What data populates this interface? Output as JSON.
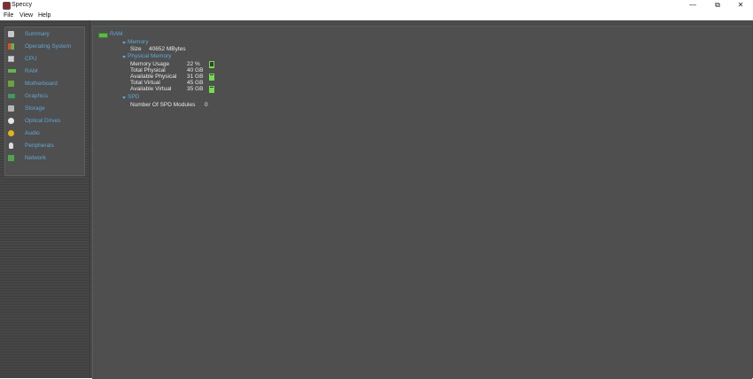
{
  "window": {
    "title": "Speccy",
    "minimize": "—",
    "restore": "⧉",
    "close": "✕"
  },
  "menu": [
    "File",
    "View",
    "Help"
  ],
  "sidebar": {
    "items": [
      {
        "label": "Summary",
        "icon": "summary-icon",
        "color": "#c8c8c8"
      },
      {
        "label": "Operating System",
        "icon": "windows-icon",
        "color": "#d97a2b"
      },
      {
        "label": "CPU",
        "icon": "cpu-icon",
        "color": "#cfcfcf"
      },
      {
        "label": "RAM",
        "icon": "ram-icon",
        "color": "#5fb84a"
      },
      {
        "label": "Motherboard",
        "icon": "motherboard-icon",
        "color": "#6aa43d"
      },
      {
        "label": "Graphics",
        "icon": "graphics-card-icon",
        "color": "#3f9a5a"
      },
      {
        "label": "Storage",
        "icon": "storage-icon",
        "color": "#b7b7b7"
      },
      {
        "label": "Optical Drives",
        "icon": "optical-drive-icon",
        "color": "#e5e5e5"
      },
      {
        "label": "Audio",
        "icon": "audio-icon",
        "color": "#e2b51c"
      },
      {
        "label": "Peripherals",
        "icon": "peripherals-icon",
        "color": "#dcdcdc"
      },
      {
        "label": "Network",
        "icon": "network-icon",
        "color": "#4fa54f"
      }
    ]
  },
  "content": {
    "heading": "RAM",
    "memory_section": "Memory",
    "size_label": "Size",
    "size_value": "40652 MBytes",
    "physical_section": "Physical Memory",
    "rows": [
      {
        "label": "Memory Usage",
        "value": "22 %",
        "level": 0.22
      },
      {
        "label": "Total Physical",
        "value": "40 GB"
      },
      {
        "label": "Available Physical",
        "value": "31 GB",
        "level": 0.78
      },
      {
        "label": "Total Virtual",
        "value": "45 GB"
      },
      {
        "label": "Available Virtual",
        "value": "35 GB",
        "level": 0.78
      }
    ],
    "spd_section": "SPD",
    "spd_label": "Number Of SPD Modules",
    "spd_value": "0"
  },
  "colors": {
    "accent": "#5ea8d6",
    "bar": "#6fe04a",
    "background": "#4b4b4b"
  }
}
